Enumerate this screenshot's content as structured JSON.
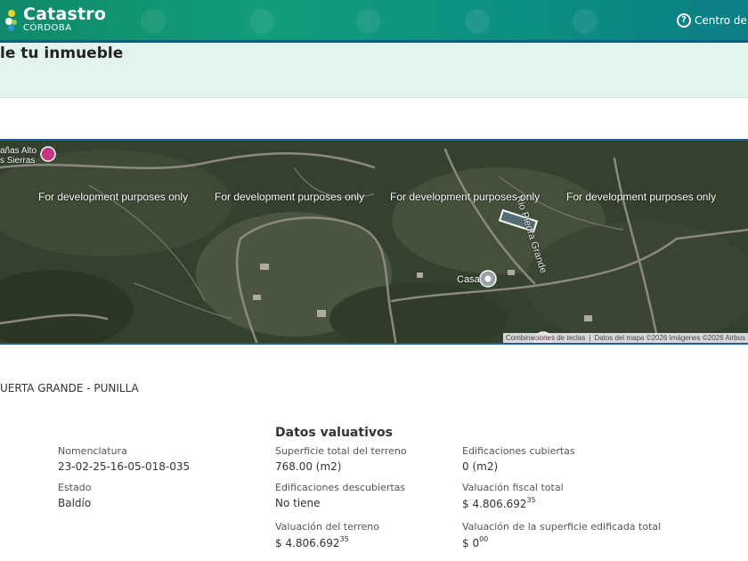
{
  "header": {
    "logo_title": "Catastro",
    "logo_subtitle": "CÓRDOBA",
    "help_label": "Centro de ay"
  },
  "page": {
    "title": "le tu inmueble",
    "locality": "UERTA GRANDE - PUNILLA"
  },
  "map": {
    "dev_notice": "For development purposes only",
    "place_top_left": "añas Alto\ns Sierras",
    "place_marker": "Casa",
    "river_label": "Rio Piedra Grande",
    "attribution": {
      "shortcuts": "Combinaciones de teclas",
      "data": "Datos del mapa ©2026 Imágenes ©2026 Airbus"
    }
  },
  "details": {
    "section_title": "Datos valuativos",
    "nomenclatura": {
      "label": "Nomenclatura",
      "value": "23-02-25-16-05-018-035"
    },
    "estado": {
      "label": "Estado",
      "value": "Baldío"
    },
    "superficie_total": {
      "label": "Superficie total del terreno",
      "value": "768.00 (m2)"
    },
    "edif_descubiertas": {
      "label": "Edificaciones descubiertas",
      "value": "No tiene"
    },
    "valuacion_terreno": {
      "label": "Valuación del terreno",
      "value": "$ 4.806.692",
      "cents": "35"
    },
    "edif_cubiertas": {
      "label": "Edificaciones cubiertas",
      "value": "0 (m2)"
    },
    "valuacion_fiscal": {
      "label": "Valuación fiscal total",
      "value": "$ 4.806.692",
      "cents": "35"
    },
    "valuacion_edificada": {
      "label": "Valuación de la superficie edificada total",
      "value": "$ 0",
      "cents": "00"
    }
  }
}
